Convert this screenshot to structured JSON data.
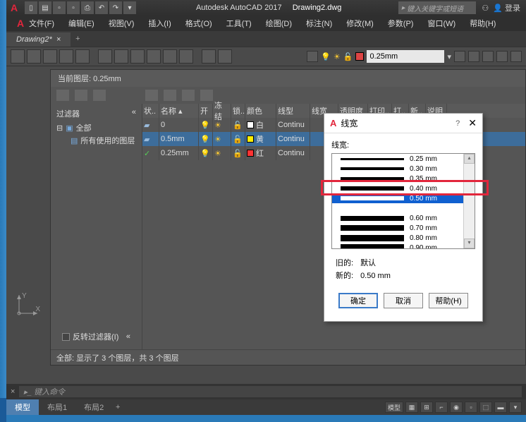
{
  "app": {
    "title": "Autodesk AutoCAD 2017",
    "filename": "Drawing2.dwg"
  },
  "search": {
    "placeholder": "键入关键字或短语"
  },
  "user": {
    "login": "登录"
  },
  "menu": [
    {
      "l": "文件(F)"
    },
    {
      "l": "编辑(E)"
    },
    {
      "l": "视图(V)"
    },
    {
      "l": "插入(I)"
    },
    {
      "l": "格式(O)"
    },
    {
      "l": "工具(T)"
    },
    {
      "l": "绘图(D)"
    },
    {
      "l": "标注(N)"
    },
    {
      "l": "修改(M)"
    },
    {
      "l": "参数(P)"
    },
    {
      "l": "窗口(W)"
    },
    {
      "l": "帮助(H)"
    }
  ],
  "doctab": {
    "name": "Drawing2*"
  },
  "lw_toolbar": {
    "current": "0.25mm"
  },
  "layer_panel": {
    "header": "当前图层: 0.25mm",
    "filter_title": "过滤器",
    "collapse": "«",
    "tree_root": "全部",
    "tree_used": "所有使用的图层",
    "cols": {
      "state": "状..",
      "name": "名称",
      "on": "开",
      "freeze": "冻结",
      "lock": "锁..",
      "color": "颜色",
      "ltype": "线型",
      "lw": "线宽",
      "trans": "透明度",
      "plot": "打印..",
      "pl2": "打..",
      "new": "新..",
      "desc": "说明"
    },
    "rows": [
      {
        "name": "0",
        "color": "#fff",
        "cname": "白",
        "ltype": "Continu"
      },
      {
        "name": "0.5mm",
        "color": "#fe0",
        "cname": "黄",
        "ltype": "Continu"
      },
      {
        "name": "0.25mm",
        "color": "#f33",
        "cname": "红",
        "ltype": "Continu",
        "current": true
      }
    ],
    "invert": "反转过滤器(I)",
    "status": "全部: 显示了 3 个图层，共 3 个图层"
  },
  "axis": {
    "y": "Y",
    "x": "X"
  },
  "cmd": {
    "placeholder": "键入命令"
  },
  "model_tabs": {
    "model": "模型",
    "l1": "布局1",
    "l2": "布局2",
    "sb_model": "模型"
  },
  "dialog": {
    "title": "线宽",
    "label": "线宽:",
    "items": [
      {
        "w": 4,
        "t": "0.25 mm"
      },
      {
        "w": 5,
        "t": "0.30 mm"
      },
      {
        "w": 6,
        "t": "0.35 mm"
      },
      {
        "w": 7,
        "t": "0.40 mm"
      },
      {
        "w": 8,
        "t": "0.50 mm",
        "sel": true
      },
      {
        "w": 0,
        "t": ""
      },
      {
        "w": 9,
        "t": "0.60 mm"
      },
      {
        "w": 10,
        "t": "0.70 mm"
      },
      {
        "w": 11,
        "t": "0.80 mm"
      },
      {
        "w": 12,
        "t": "0.90 mm"
      }
    ],
    "old_l": "旧的:",
    "old_v": "默认",
    "new_l": "新的:",
    "new_v": "0.50 mm",
    "ok": "确定",
    "cancel": "取消",
    "help": "帮助(H)"
  }
}
